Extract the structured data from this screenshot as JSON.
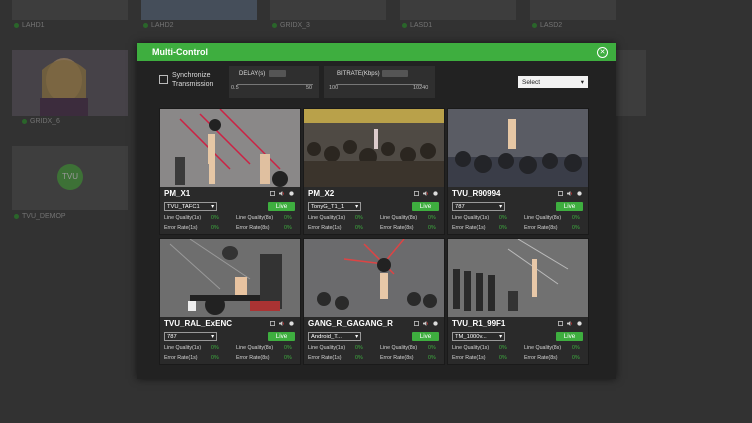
{
  "background": {
    "tiles": [
      {
        "label": "LAHD1"
      },
      {
        "label": "LAHD2"
      },
      {
        "label": "GRIDX_3"
      },
      {
        "label": "LASD1"
      },
      {
        "label": "LASD2"
      },
      {
        "label": "GRIDX_6"
      },
      {
        "label": "TVU_DEMOP"
      }
    ],
    "tvu_logo_text": "TVU"
  },
  "modal": {
    "title": "Multi-Control",
    "sync_label_line1": "Synchronize",
    "sync_label_line2": "Transmission",
    "delay": {
      "title": "DELAY(s)",
      "min": "0.5",
      "max": "50"
    },
    "bitrate": {
      "title": "BITRATE(Kbps)",
      "min": "100",
      "max": "10240"
    },
    "select_label": "Select"
  },
  "cards": [
    {
      "name": "PM_X1",
      "source": "TVU_TAFC1",
      "live": "Live",
      "q1": "Line Quality(1s)",
      "q8": "Line Quality(8s)",
      "e1": "Error Rate(1s)",
      "e8": "Error Rate(8s)",
      "v1": "0%",
      "v2": "0%",
      "v3": "0%",
      "v4": "0%"
    },
    {
      "name": "PM_X2",
      "source": "TonyG_T1_1",
      "live": "Live",
      "q1": "Line Quality(1s)",
      "q8": "Line Quality(8s)",
      "e1": "Error Rate(1s)",
      "e8": "Error Rate(8s)",
      "v1": "0%",
      "v2": "0%",
      "v3": "0%",
      "v4": "0%"
    },
    {
      "name": "TVU_R90994",
      "source": "787",
      "live": "Live",
      "q1": "Line Quality(1s)",
      "q8": "Line Quality(8s)",
      "e1": "Error Rate(1s)",
      "e8": "Error Rate(8s)",
      "v1": "0%",
      "v2": "0%",
      "v3": "0%",
      "v4": "0%"
    },
    {
      "name": "TVU_RAL_ExENC",
      "source": "787",
      "live": "Live",
      "q1": "Line Quality(1s)",
      "q8": "Line Quality(8s)",
      "e1": "Error Rate(1s)",
      "e8": "Error Rate(8s)",
      "v1": "0%",
      "v2": "0%",
      "v3": "0%",
      "v4": "0%"
    },
    {
      "name": "GANG_R_GAGANG_R",
      "source": "Android_T...",
      "live": "Live",
      "q1": "Line Quality(1s)",
      "q8": "Line Quality(8s)",
      "e1": "Error Rate(1s)",
      "e8": "Error Rate(8s)",
      "v1": "0%",
      "v2": "0%",
      "v3": "0%",
      "v4": "0%"
    },
    {
      "name": "TVU_R1_99F1",
      "source": "TM_1000v...",
      "live": "Live",
      "q1": "Line Quality(1s)",
      "q8": "Line Quality(8s)",
      "e1": "Error Rate(1s)",
      "e8": "Error Rate(8s)",
      "v1": "0%",
      "v2": "0%",
      "v3": "0%",
      "v4": "0%"
    }
  ],
  "colors": {
    "accent": "#3eae3f",
    "modal_bg": "#222222",
    "page_bg": "#474747"
  }
}
